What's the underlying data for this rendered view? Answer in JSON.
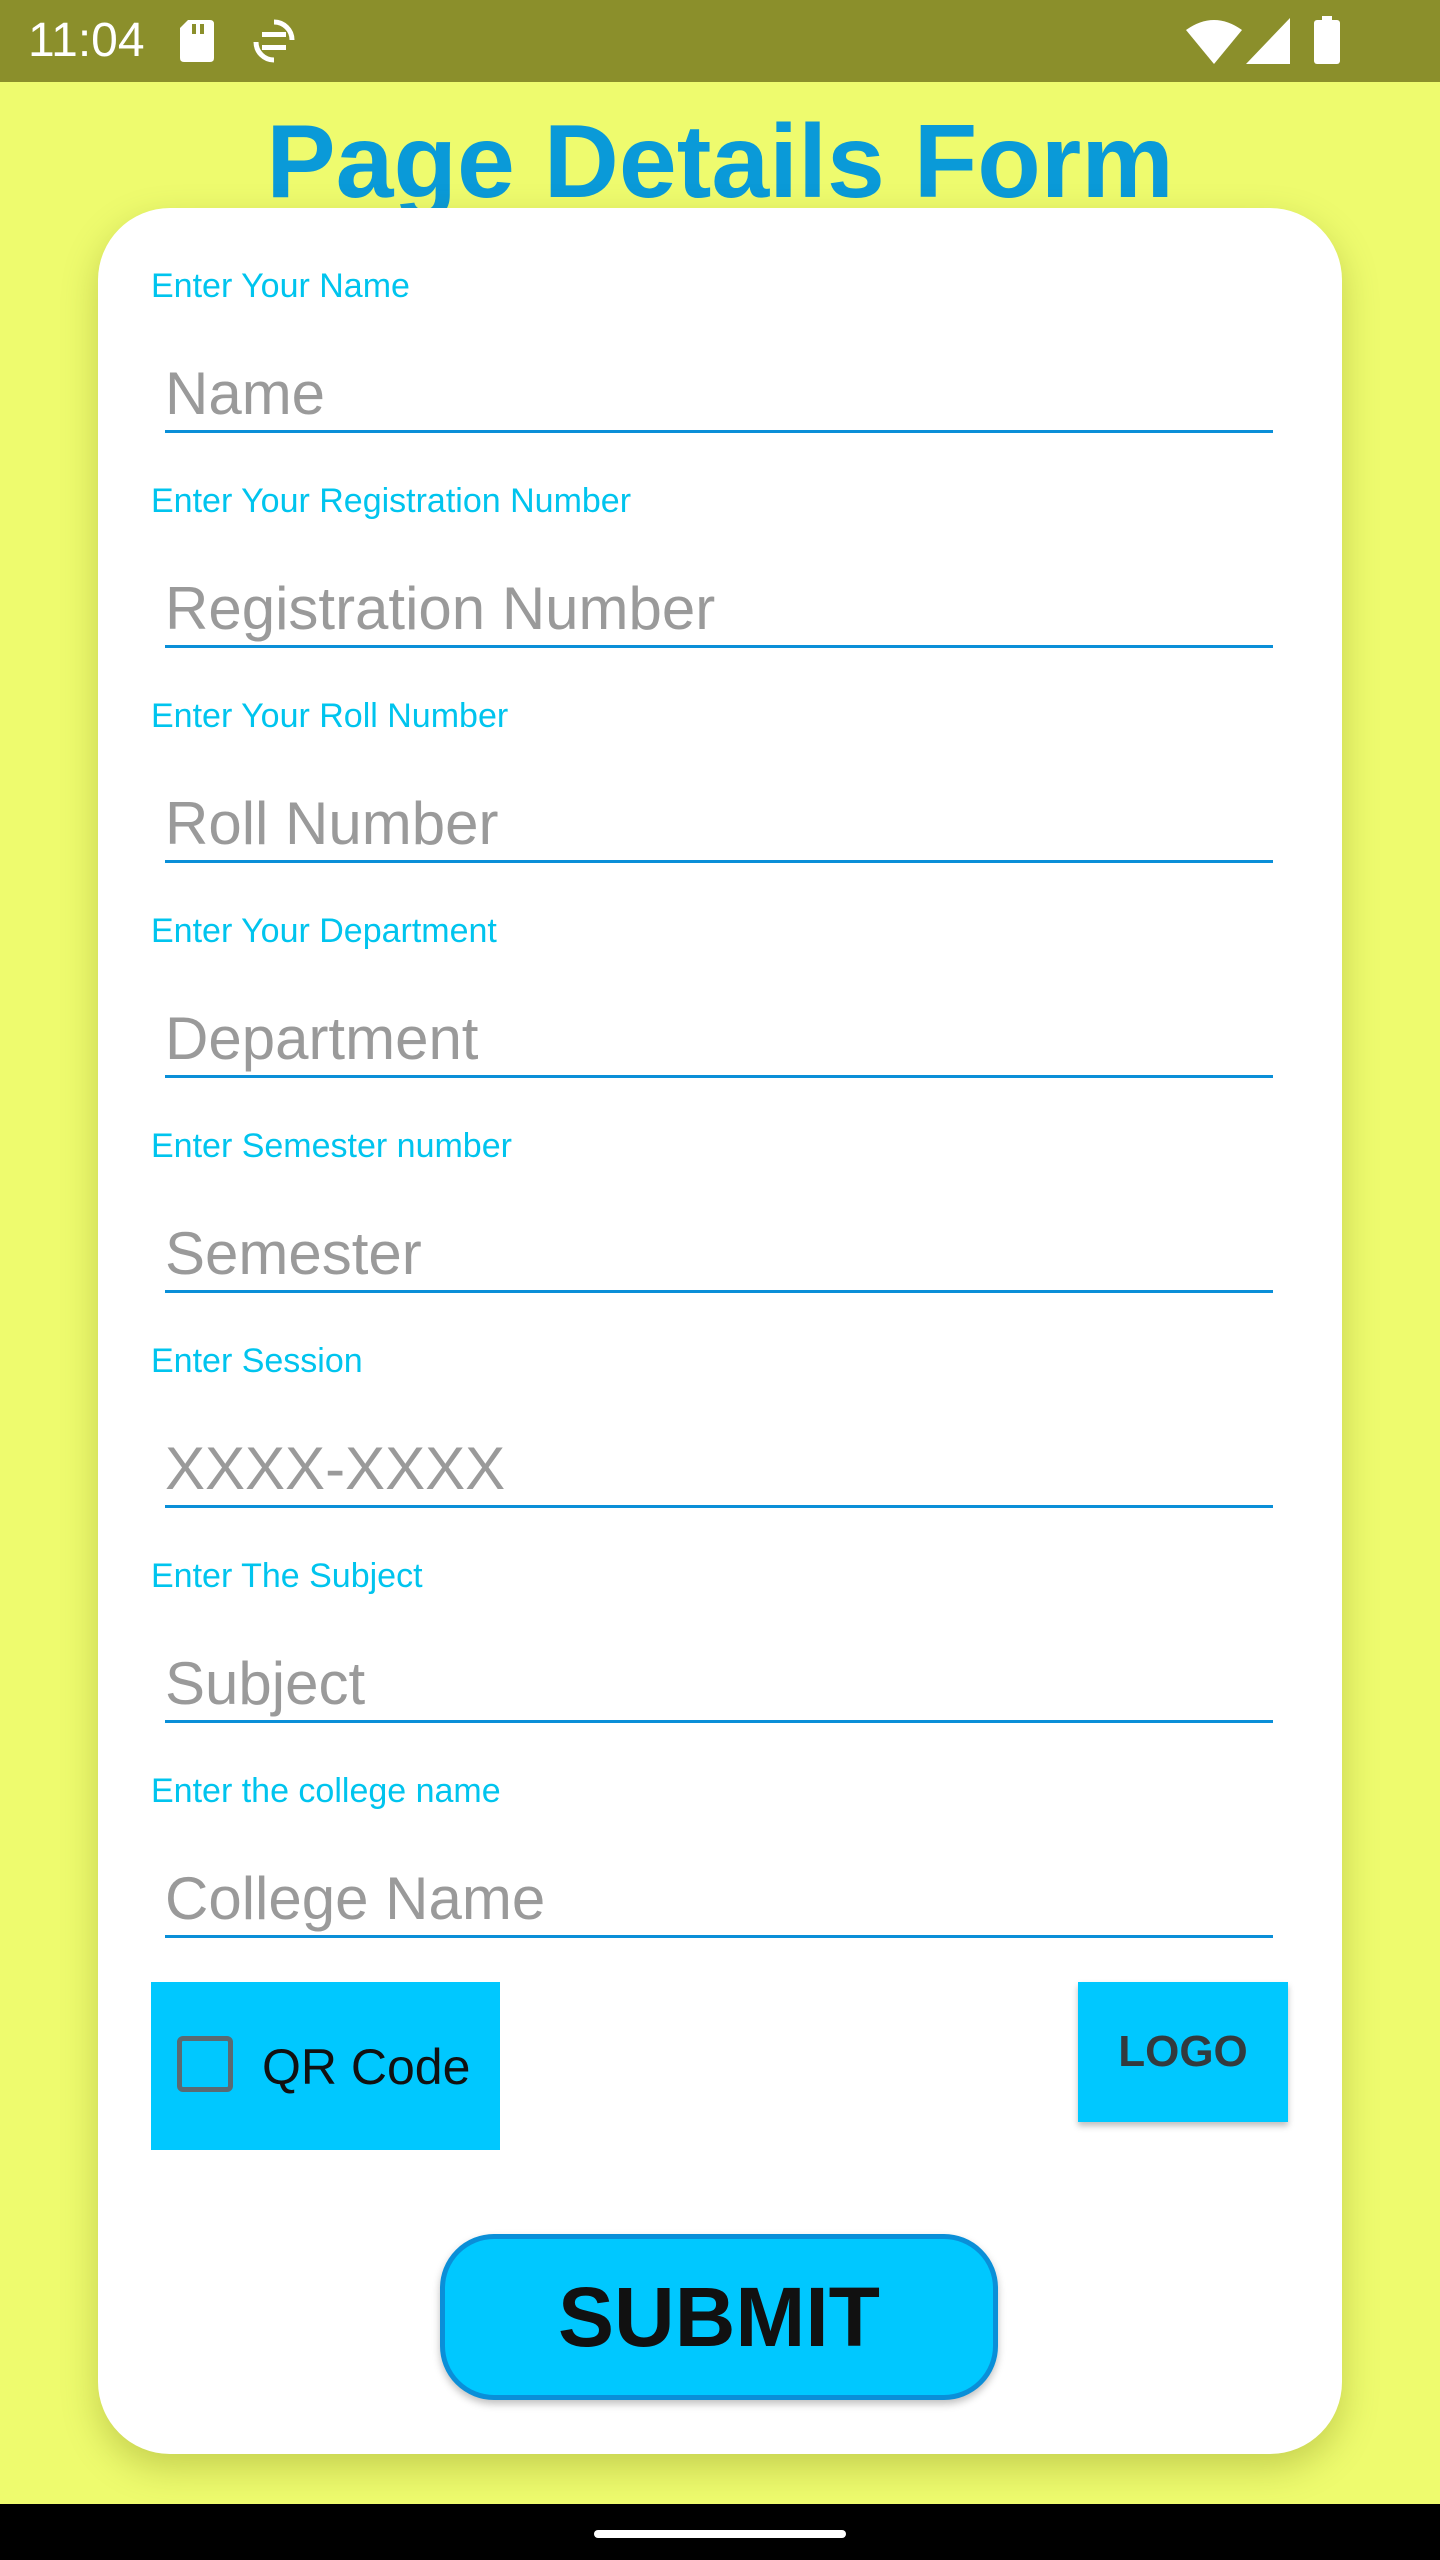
{
  "status_bar": {
    "time": "11:04",
    "icons": [
      "sd-card-icon",
      "sync-icon",
      "wifi-icon",
      "signal-icon",
      "battery-icon"
    ]
  },
  "form": {
    "title": "Page Details Form",
    "fields": [
      {
        "label": "Enter Your Name",
        "placeholder": "Name"
      },
      {
        "label": "Enter Your Registration Number",
        "placeholder": "Registration Number"
      },
      {
        "label": "Enter Your Roll Number",
        "placeholder": "Roll Number"
      },
      {
        "label": "Enter Your Department",
        "placeholder": "Department"
      },
      {
        "label": "Enter Semester number",
        "placeholder": "Semester"
      },
      {
        "label": "Enter Session",
        "placeholder": "XXXX-XXXX"
      },
      {
        "label": "Enter The Subject",
        "placeholder": "Subject"
      },
      {
        "label": "Enter the college name",
        "placeholder": "College Name"
      }
    ],
    "qr_checkbox_label": "QR Code",
    "qr_checked": false,
    "logo_button": "LOGO",
    "submit_button": "SUBMIT"
  },
  "colors": {
    "background": "#eefb6e",
    "status_bar": "#8b8f2b",
    "title": "#0a9ad8",
    "label": "#00c4ee",
    "accent": "#00c8ff",
    "underline": "#0a8fd8"
  }
}
